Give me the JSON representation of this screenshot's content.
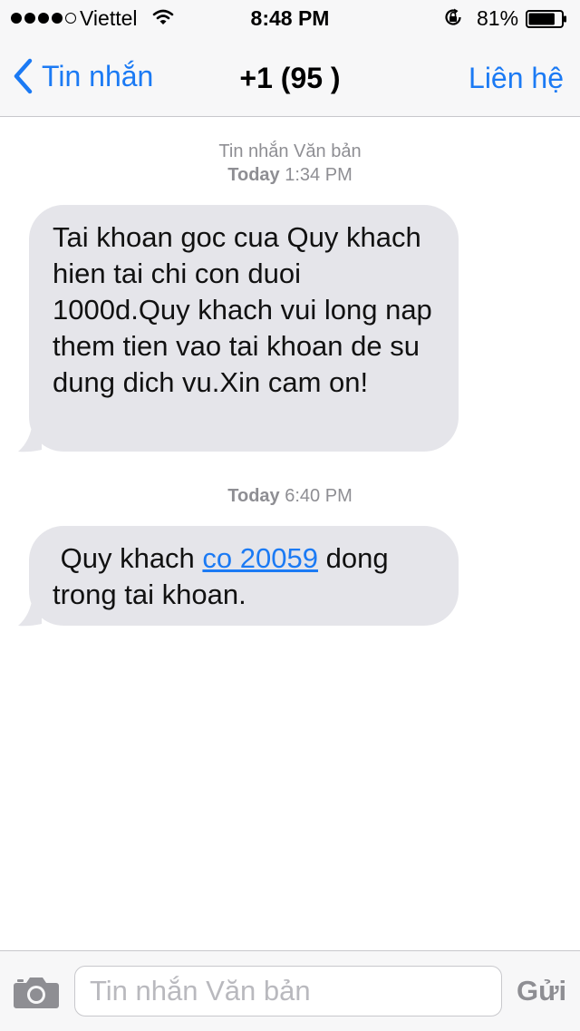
{
  "status_bar": {
    "carrier": "Viettel",
    "time": "8:48 PM",
    "battery_percent": "81%",
    "battery_level": 0.81,
    "signal_bars_filled": 4,
    "signal_bars_total": 5
  },
  "nav": {
    "back_label": "Tin nhắn",
    "title": "+1 (95 )",
    "contact_label": "Liên hệ"
  },
  "thread": {
    "header_label": "Tin nhắn Văn bản",
    "first_stamp_day": "Today",
    "first_stamp_time": "1:34 PM",
    "message1": "Tai khoan goc cua Quy khach hien tai chi con duoi 1000d.Quy khach vui long nap them tien vao tai khoan de su dung dich vu.Xin cam on!",
    "second_stamp_day": "Today",
    "second_stamp_time": "6:40 PM",
    "message2_before": " Quy khach ",
    "message2_link": "co 20059",
    "message2_after": " dong trong tai khoan."
  },
  "compose": {
    "placeholder": "Tin nhắn Văn bản",
    "send_label": "Gửi"
  },
  "colors": {
    "accent": "#1b7af4",
    "bubble": "#e5e5ea",
    "bar_background": "#f7f7f8",
    "muted_text": "#8e8e93"
  },
  "icons": [
    "back-chevron-icon",
    "wifi-icon",
    "rotation-lock-icon",
    "battery-icon",
    "camera-icon"
  ]
}
